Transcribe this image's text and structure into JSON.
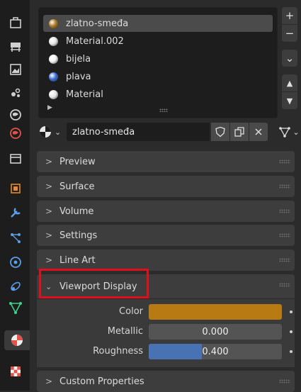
{
  "tabs": [
    {
      "name": "tool-icon",
      "color": "#cfcfcf"
    },
    {
      "name": "render-icon",
      "color": "#cfcfcf"
    },
    {
      "name": "output-icon",
      "color": "#cfcfcf"
    },
    {
      "name": "view-layer-icon",
      "color": "#cfcfcf"
    },
    {
      "name": "scene-icon",
      "color": "#cfcfcf"
    },
    {
      "name": "world-icon",
      "color": "#e0534a"
    },
    {
      "name": "collection-icon",
      "color": "#cfcfcf"
    },
    {
      "name": "object-icon",
      "color": "#e48a26"
    },
    {
      "name": "modifier-icon",
      "color": "#5a9fe8"
    },
    {
      "name": "particles-icon",
      "color": "#5a9fe8"
    },
    {
      "name": "physics-icon",
      "color": "#5a9fe8"
    },
    {
      "name": "constraints-icon",
      "color": "#5a9fe8"
    },
    {
      "name": "object-data-icon",
      "color": "#3fd28c"
    },
    {
      "name": "material-icon",
      "color": "#e0534a",
      "active": true
    },
    {
      "name": "texture-icon",
      "color": "#e0534a"
    }
  ],
  "slots": [
    {
      "name": "zlatno-smeđa",
      "color": "#b07820",
      "selected": true
    },
    {
      "name": "Material.002",
      "color": "#e6e6e6"
    },
    {
      "name": "bijela",
      "color": "#f2f2f2"
    },
    {
      "name": "plava",
      "color": "#3c6fd8"
    },
    {
      "name": "Material",
      "color": "#e6e6e6"
    }
  ],
  "side_buttons": {
    "add": "+",
    "remove": "−",
    "menu": "⌄",
    "up": "▲",
    "down": "▼"
  },
  "material_field": {
    "name": "zlatno-smeđa"
  },
  "panels": {
    "preview": "Preview",
    "surface": "Surface",
    "volume": "Volume",
    "settings": "Settings",
    "line_art": "Line Art",
    "viewport_display": "Viewport Display",
    "custom_properties": "Custom Properties"
  },
  "viewport": {
    "color_label": "Color",
    "color_value": "#b87a12",
    "metallic_label": "Metallic",
    "metallic_value": "0.000",
    "metallic_fraction": 0.0,
    "roughness_label": "Roughness",
    "roughness_value": "0.400",
    "roughness_fraction": 0.4
  }
}
